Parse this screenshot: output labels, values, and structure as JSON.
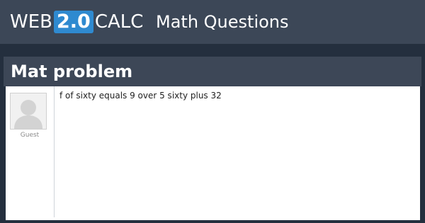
{
  "header": {
    "logo": {
      "web": "WEB",
      "version": "2.0",
      "calc": "CALC"
    },
    "section": "Math Questions"
  },
  "question": {
    "title": "Mat problem",
    "author": "Guest",
    "avatar_icon": "default-user-avatar-icon",
    "body": "f of sixty equals 9 over 5 sixty plus 32"
  },
  "colors": {
    "background": "#242f3e",
    "header": "#3c4757",
    "logo_badge": "#2f8ad0",
    "text_light": "#ffffff"
  }
}
